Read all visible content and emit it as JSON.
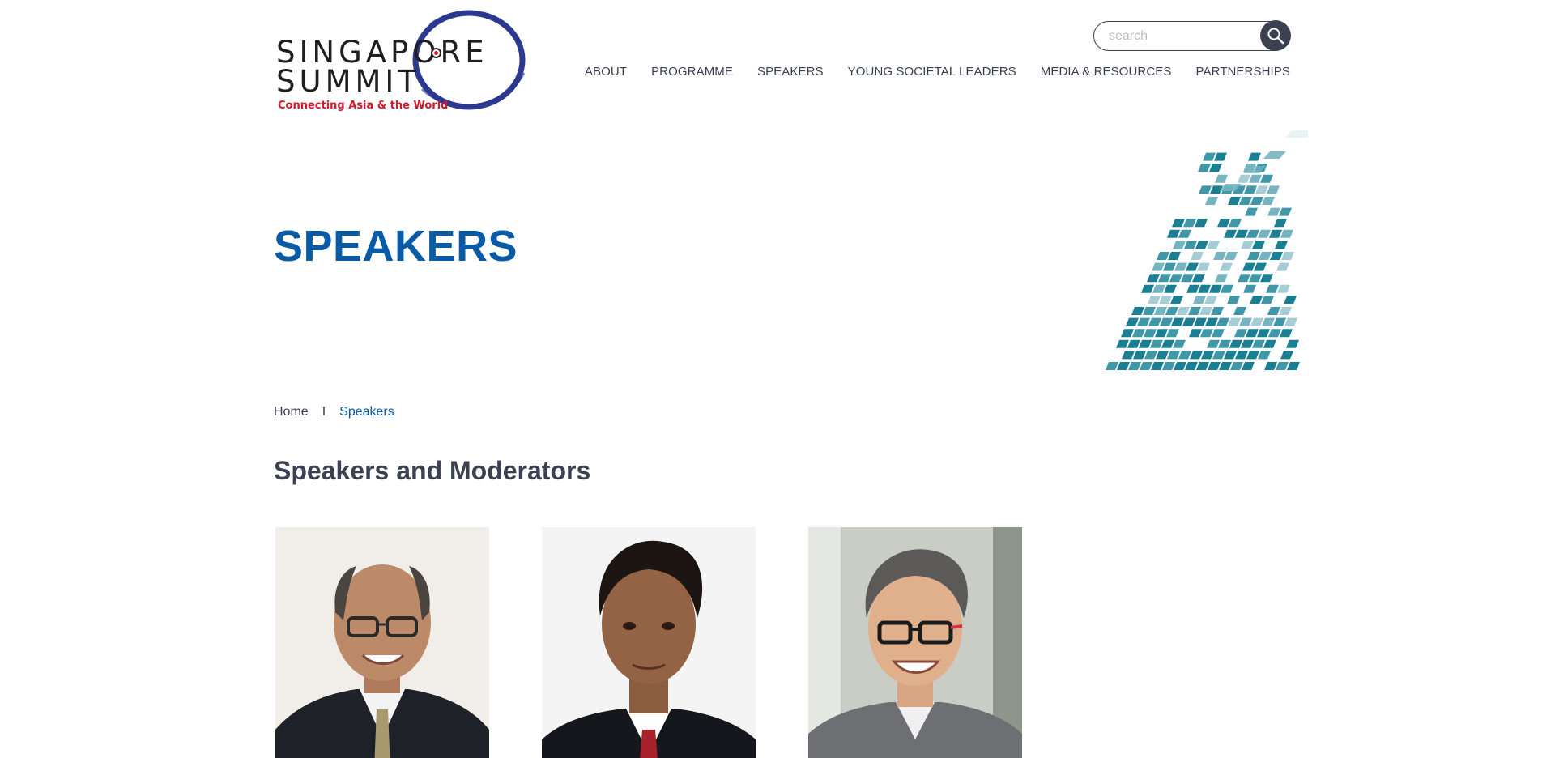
{
  "logo": {
    "line1": "SINGAPORE",
    "line2": "SUMMIT",
    "tagline": "Connecting Asia & the World"
  },
  "search": {
    "placeholder": "search"
  },
  "nav": {
    "items": [
      {
        "label": "ABOUT"
      },
      {
        "label": "PROGRAMME"
      },
      {
        "label": "SPEAKERS"
      },
      {
        "label": "YOUNG SOCIETAL LEADERS"
      },
      {
        "label": "MEDIA & RESOURCES"
      },
      {
        "label": "PARTNERSHIPS"
      }
    ]
  },
  "hero": {
    "title": "SPEAKERS"
  },
  "breadcrumb": {
    "home": "Home",
    "separator": "I",
    "current": "Speakers"
  },
  "section": {
    "title": "Speakers and Moderators"
  },
  "colors": {
    "brand_blue": "#0a5ba5",
    "text": "#3c4151",
    "tagline_red": "#d11a2a",
    "mosaic_teal": "#1a7f93"
  }
}
